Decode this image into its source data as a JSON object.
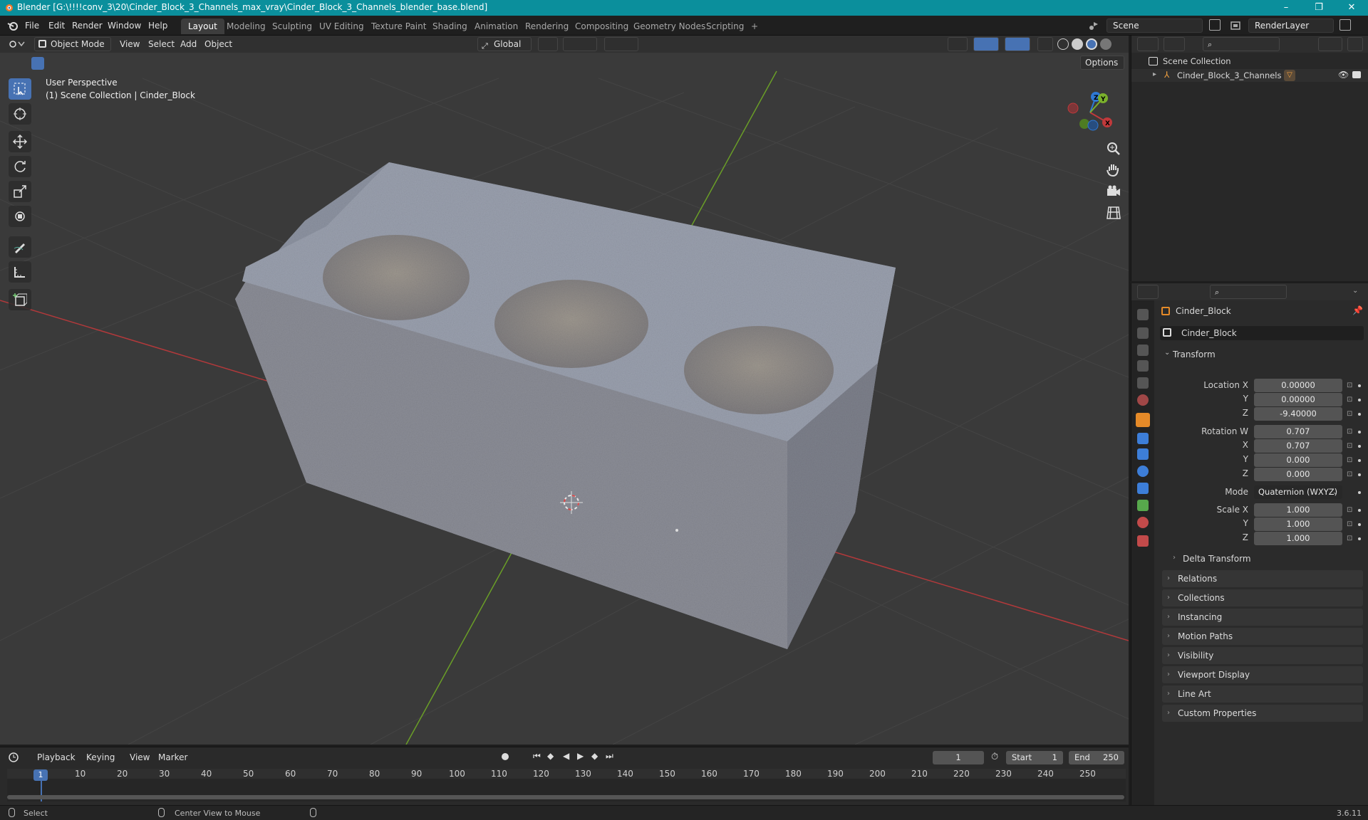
{
  "window": {
    "title": "Blender [G:\\!!!!conv_3\\20\\Cinder_Block_3_Channels_max_vray\\Cinder_Block_3_Channels_blender_base.blend]",
    "minimize": "–",
    "maximize": "❐",
    "close": "✕"
  },
  "menubar": {
    "items": [
      "File",
      "Edit",
      "Render",
      "Window",
      "Help"
    ],
    "workspaces": [
      "Layout",
      "Modeling",
      "Sculpting",
      "UV Editing",
      "Texture Paint",
      "Shading",
      "Animation",
      "Rendering",
      "Compositing",
      "Geometry Nodes",
      "Scripting"
    ],
    "add_workspace": "+",
    "scene": "Scene",
    "render_layer": "RenderLayer"
  },
  "viewport": {
    "mode": "Object Mode",
    "menus": [
      "View",
      "Select",
      "Add",
      "Object"
    ],
    "transform_orientation": "Global",
    "options": "Options",
    "overlay_line1": "User Perspective",
    "overlay_line2": "(1) Scene Collection | Cinder_Block",
    "gizmo": {
      "x": "X",
      "y": "Y",
      "z": "Z"
    }
  },
  "outliner": {
    "root": "Scene Collection",
    "items": [
      {
        "name": "Cinder_Block_3_Channels"
      }
    ]
  },
  "properties": {
    "object_name": "Cinder_Block",
    "data_name": "Cinder_Block",
    "transform_title": "Transform",
    "location_label": "Location X",
    "location": [
      "0.00000",
      "0.00000",
      "-9.40000"
    ],
    "rotation_label": "Rotation W",
    "rotation": [
      "0.707",
      "0.707",
      "0.000",
      "0.000"
    ],
    "mode_label": "Mode",
    "mode_value": "Quaternion (WXYZ)",
    "scale_label": "Scale X",
    "scale": [
      "1.000",
      "1.000",
      "1.000"
    ],
    "axis_y": "Y",
    "axis_x": "X",
    "axis_z": "Z",
    "delta_transform": "Delta Transform",
    "panels": [
      "Relations",
      "Collections",
      "Instancing",
      "Motion Paths",
      "Visibility",
      "Viewport Display",
      "Line Art",
      "Custom Properties"
    ]
  },
  "timeline": {
    "menus": [
      "Playback",
      "Keying",
      "View",
      "Marker"
    ],
    "current_frame": "1",
    "start_label": "Start",
    "start": "1",
    "end_label": "End",
    "end": "250",
    "frame_marker": "1",
    "ticks": [
      "10",
      "20",
      "30",
      "40",
      "50",
      "60",
      "70",
      "80",
      "90",
      "100",
      "110",
      "120",
      "130",
      "140",
      "150",
      "160",
      "170",
      "180",
      "190",
      "200",
      "210",
      "220",
      "230",
      "240",
      "250"
    ]
  },
  "statusbar": {
    "select": "Select",
    "center_view": "Center View to Mouse",
    "version": "3.6.11"
  },
  "colors": {
    "titlebar": "#0b8f9c",
    "accent": "#4772b3",
    "x_axis": "#c0393b",
    "y_axis": "#7ab02c",
    "z_axis": "#2e79d4"
  }
}
